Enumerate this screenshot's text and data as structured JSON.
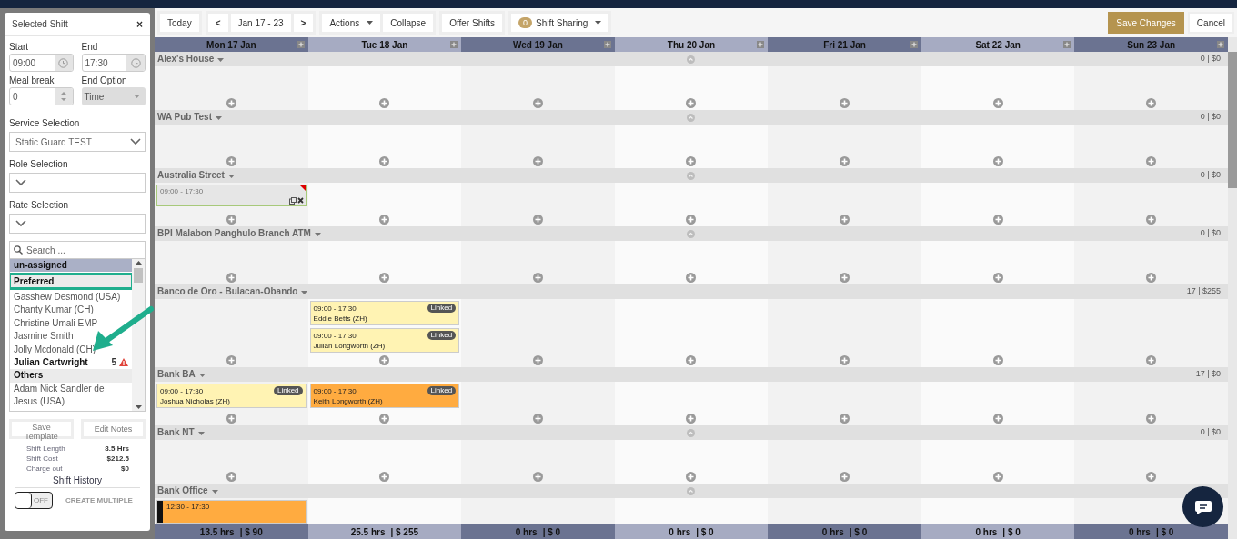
{
  "panel": {
    "title": "Selected Shift",
    "close": "×",
    "start": {
      "label": "Start",
      "value": "09:00"
    },
    "end": {
      "label": "End",
      "value": "17:30"
    },
    "meal_break": {
      "label": "Meal break",
      "value": "0"
    },
    "end_option": {
      "label": "End Option",
      "value": "Time",
      "disabled": true
    },
    "service": {
      "label": "Service Selection",
      "value": "Static Guard TEST"
    },
    "role": {
      "label": "Role Selection"
    },
    "rate": {
      "label": "Rate Selection"
    },
    "search": {
      "placeholder": "Search ..."
    },
    "staff": [
      {
        "kind": "group",
        "label": "un-assigned",
        "selected": true,
        "highlighted": false
      },
      {
        "kind": "group",
        "label": "Preferred",
        "selected": false,
        "highlighted": true
      },
      {
        "kind": "person",
        "label": "Gasshew Desmond (USA)",
        "selected": false
      },
      {
        "kind": "person",
        "label": "Chanty Kumar (CH)",
        "selected": false
      },
      {
        "kind": "person",
        "label": "Christine Umali EMP",
        "selected": false
      },
      {
        "kind": "person",
        "label": "Jasmine Smith",
        "selected": false
      },
      {
        "kind": "person",
        "label": "Jolly Mcdonald (CH)",
        "selected": false
      },
      {
        "kind": "person",
        "label": "Julian Cartwright",
        "count": "5",
        "warning": true,
        "bold": true,
        "selected": false
      },
      {
        "kind": "group",
        "label": "Others",
        "selected": false,
        "highlighted": false
      },
      {
        "kind": "person",
        "label": "Adam Nick Sandler de Jesus (USA)",
        "selected": false
      }
    ],
    "buttons": [
      "Save Template",
      "Edit Notes"
    ],
    "stats": [
      {
        "label": "Shift Length",
        "value": "8.5 Hrs"
      },
      {
        "label": "Shift Cost",
        "value": "$212.5"
      },
      {
        "label": "Charge out",
        "value": "$0"
      }
    ],
    "history_link": "Shift History",
    "toggle": {
      "on": false,
      "text": "OFF",
      "label": "CREATE MULTIPLE"
    }
  },
  "toolbar": {
    "today": "Today",
    "prev": "<",
    "range": "Jan 17 - 23",
    "next": ">",
    "actions": "Actions",
    "collapse": "Collapse",
    "offer": "Offer Shifts",
    "sharing_count": "0",
    "sharing": "Shift Sharing",
    "save": "Save Changes",
    "cancel": "Cancel"
  },
  "days": [
    "Mon 17 Jan",
    "Tue 18 Jan",
    "Wed 19 Jan",
    "Thu 20 Jan",
    "Fri 21 Jan",
    "Sat 22 Jan",
    "Sun 23 Jan"
  ],
  "groups": [
    {
      "name": "Alex's House",
      "total": "0 | $0",
      "marker": true,
      "cells": [
        [],
        [],
        [],
        [],
        [],
        [],
        []
      ]
    },
    {
      "name": "WA Pub Test",
      "total": "0 | $0",
      "marker": true,
      "cells": [
        [],
        [],
        [],
        [],
        [],
        [],
        []
      ]
    },
    {
      "name": "Australia Street",
      "total": "0 | $0",
      "marker": true,
      "cells": [
        [
          {
            "kind": "open",
            "time": "09:00 - 17:30"
          }
        ],
        [],
        [],
        [],
        [],
        [],
        []
      ]
    },
    {
      "name": "BPI Malabon Panghulo Branch ATM",
      "total": "0 | $0",
      "marker": true,
      "cells": [
        [],
        [],
        [],
        [],
        [],
        [],
        []
      ]
    },
    {
      "name": "Banco de Oro - Bulacan-Obando",
      "total": "17 | $255",
      "marker": false,
      "cells": [
        [],
        [
          {
            "kind": "assigned",
            "time": "09:00 - 17:30",
            "name": "Eddie Betts (ZH)",
            "badge": "Linked",
            "color": "#fff3b3"
          },
          {
            "kind": "assigned",
            "time": "09:00 - 17:30",
            "name": "Julian Longworth (ZH)",
            "badge": "Linked",
            "color": "#fff3b3"
          }
        ],
        [],
        [],
        [],
        [],
        []
      ]
    },
    {
      "name": "Bank BA",
      "total": "17 | $0",
      "marker": false,
      "cells": [
        [
          {
            "kind": "assigned",
            "time": "09:00 - 17:30",
            "name": "Joshua Nicholas (ZH)",
            "badge": "Linked",
            "color": "#fff3b3"
          }
        ],
        [
          {
            "kind": "assigned",
            "time": "09:00 - 17:30",
            "name": "Keith Longworth (ZH)",
            "badge": "Linked",
            "color": "#ffab40"
          }
        ],
        [],
        [],
        [],
        [],
        []
      ]
    },
    {
      "name": "Bank NT",
      "total": "0 | $0",
      "marker": true,
      "cells": [
        [],
        [],
        [],
        [],
        [],
        [],
        []
      ]
    },
    {
      "name": "Bank Office",
      "marker": true,
      "cells": [
        [
          {
            "kind": "partial",
            "time": "12:30 - 17:30",
            "color": "#ffab40"
          }
        ],
        [],
        [],
        [],
        [],
        [],
        []
      ]
    }
  ],
  "footer": [
    {
      "hours": "13.5 hrs",
      "cost": "| $ 90"
    },
    {
      "hours": "25.5 hrs",
      "cost": "| $ 255"
    },
    {
      "hours": "0 hrs",
      "cost": "| $ 0"
    },
    {
      "hours": "0 hrs",
      "cost": "| $ 0"
    },
    {
      "hours": "0 hrs",
      "cost": "| $ 0"
    },
    {
      "hours": "0 hrs",
      "cost": "| $ 0"
    },
    {
      "hours": "0 hrs",
      "cost": "| $ 0"
    }
  ]
}
